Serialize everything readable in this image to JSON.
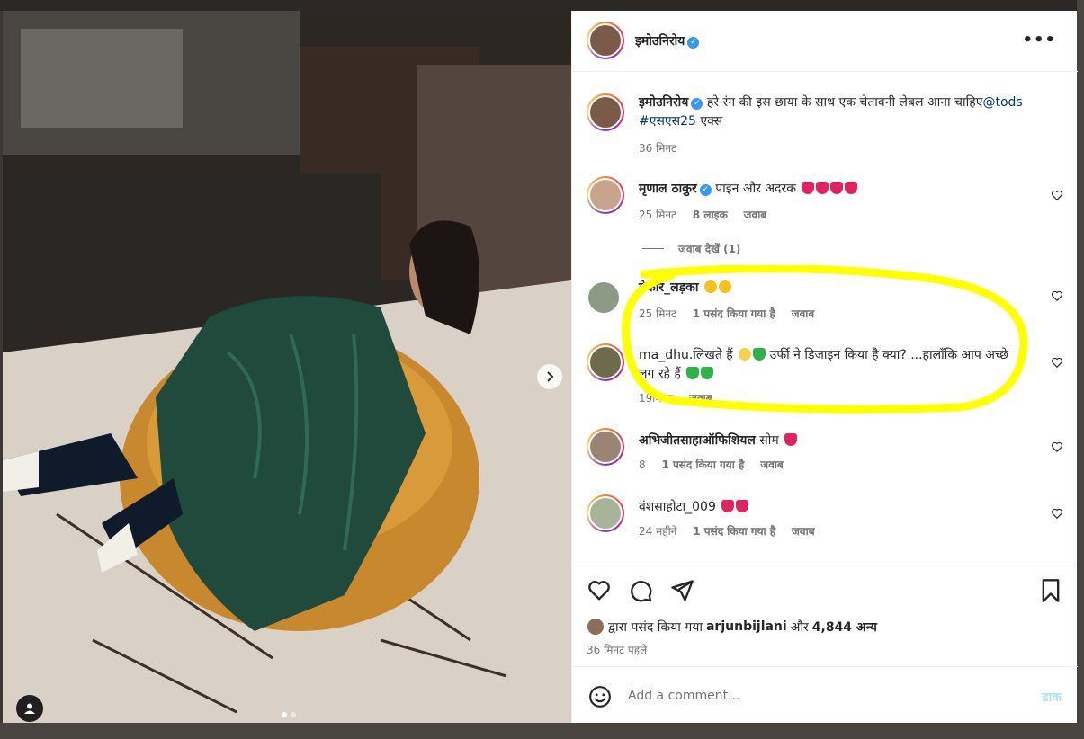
{
  "post": {
    "author": "इमोउनिरोय",
    "more_label": "•••",
    "photo_description": "woman in green leather dress on mustard pouf"
  },
  "caption": {
    "username": "इमोउनिरोय",
    "text_part1": "हरे रंग की इस छाया के साथ एक चेतावनी लेबल आना चाहिए",
    "mention": "@tods",
    "hashtag": "#एसएस25",
    "text_part2": "एक्स",
    "time": "36 मिनट"
  },
  "comments": [
    {
      "username": "मृणाल ठाकुर",
      "text": "पाइन और अदरक",
      "time": "25 मिनट",
      "likes": "8 लाइक",
      "reply": "जवाब",
      "emojis": [
        "red-heart",
        "red-heart",
        "red-heart",
        "red-heart"
      ]
    },
    {
      "username": "बेकार_लड़का",
      "text": "",
      "time": "25 मिनट",
      "likes": "1 पसंद किया गया है",
      "reply": "जवाब",
      "emojis": [
        "heart-eyes",
        "heart-eyes"
      ]
    },
    {
      "username": "ma_dhu.लिखते हैं",
      "text": "उर्फी ने डिजाइन किया है क्या? ...हालाँकि आप अच्छे लग रहे हैं",
      "time": "19मिनट",
      "likes": "",
      "reply": "जवाब",
      "emojis_before": [
        "laughing",
        "green-heart"
      ],
      "emojis_after": [
        "green-heart",
        "green-heart"
      ]
    },
    {
      "username": "अभिजीतसाहाऑफिशियल",
      "text": "सोम",
      "time": "8",
      "likes": "1 पसंद किया गया है",
      "reply": "जवाब",
      "emojis": [
        "red-heart"
      ]
    },
    {
      "username": "वंशसाहोटा_009",
      "text": "",
      "time": "24 महीने",
      "likes": "1 पसंद किया गया है",
      "reply": "जवाब",
      "emojis": [
        "red-heart",
        "red-heart"
      ]
    }
  ],
  "view_replies": "जवाब देखें (1)",
  "liked_by": {
    "prefix": "द्वारा पसंद किया गया",
    "user": "arjunbijlani",
    "and": "और",
    "count": "4,844 अन्य"
  },
  "post_time": "36 मिनट पहले",
  "composer": {
    "placeholder": "Add a comment...",
    "post_label": "डाक"
  },
  "colors": {
    "highlight": "#ffff00",
    "verified": "#3897f0",
    "heart_red": "#e0245e",
    "heart_green": "#2db34a"
  }
}
